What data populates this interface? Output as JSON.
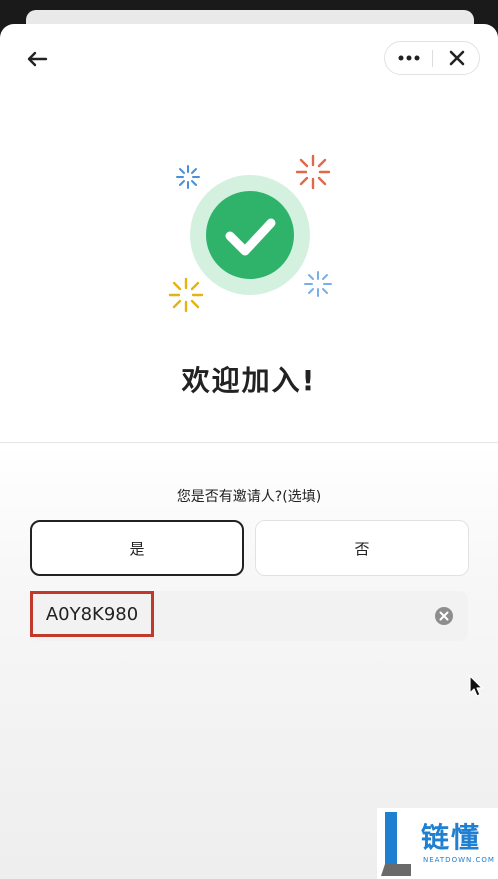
{
  "header": {
    "back_icon": "arrow-left-icon",
    "more_icon": "more-dots-icon",
    "close_icon": "close-icon"
  },
  "hero": {
    "icon": "check-circle-icon",
    "accent_color": "#2fb36b",
    "welcome_text": "欢迎加入!"
  },
  "referral": {
    "question": "您是否有邀请人?(选填)",
    "option_yes": "是",
    "option_no": "否",
    "selected": "是",
    "code_value": "A0Y8K980",
    "clear_icon": "clear-circle-icon"
  },
  "watermark": {
    "name": "链懂",
    "sub": "NEATDOWN.COM"
  }
}
